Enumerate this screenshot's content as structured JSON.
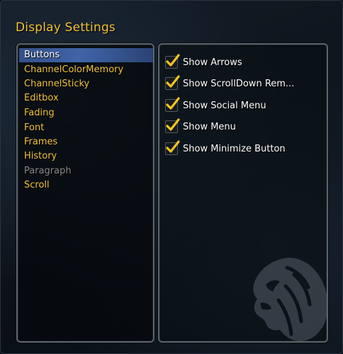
{
  "window": {
    "title": "Display Settings"
  },
  "categories": [
    {
      "label": "Buttons",
      "state": "selected"
    },
    {
      "label": "ChannelColorMemory",
      "state": "normal"
    },
    {
      "label": "ChannelSticky",
      "state": "normal"
    },
    {
      "label": "Editbox",
      "state": "normal"
    },
    {
      "label": "Fading",
      "state": "normal"
    },
    {
      "label": "Font",
      "state": "normal"
    },
    {
      "label": "Frames",
      "state": "normal"
    },
    {
      "label": "History",
      "state": "normal"
    },
    {
      "label": "Paragraph",
      "state": "disabled"
    },
    {
      "label": "Scroll",
      "state": "normal"
    }
  ],
  "options": [
    {
      "label": "Show Arrows",
      "checked": true
    },
    {
      "label": "Show ScrollDown Rem...",
      "checked": true
    },
    {
      "label": "Show Social Menu",
      "checked": true
    },
    {
      "label": "Show Menu",
      "checked": true
    },
    {
      "label": "Show Minimize Button",
      "checked": true
    }
  ],
  "colors": {
    "title": "#f2c237",
    "category_text": "#f2c237",
    "selected_text": "#ffffff",
    "disabled_text": "#8a8a8a",
    "selection_bg": "#3a5a9c",
    "checkmark": "#f3c520",
    "option_text": "#ffffff"
  },
  "icons": {
    "checkbox": "checkmark-icon",
    "watermark": "lion-head-icon"
  }
}
